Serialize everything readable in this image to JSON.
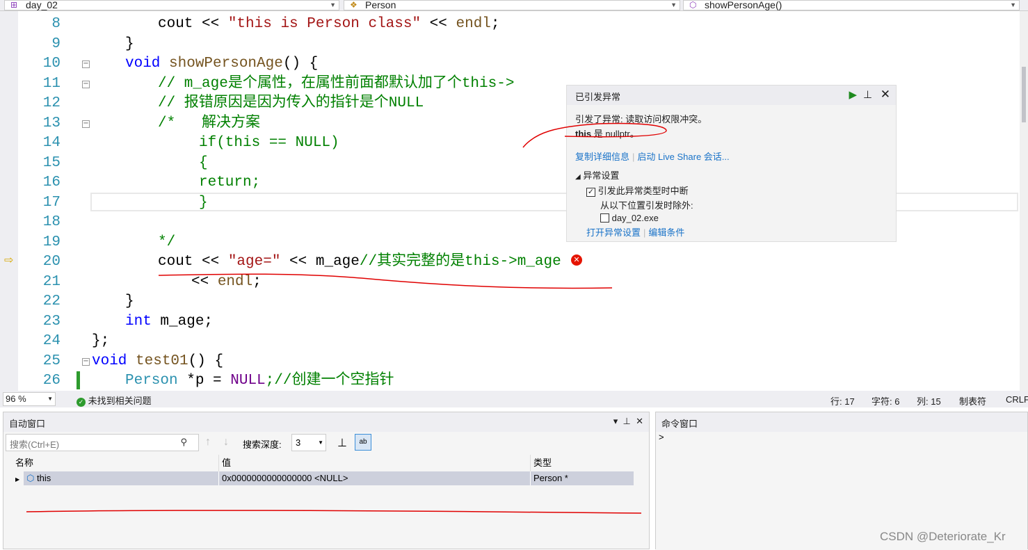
{
  "toolbar": {
    "project": "day_02",
    "class_scope": "Person",
    "member_scope": "showPersonAge()"
  },
  "colors": {
    "keyword": "#0000ff",
    "string": "#a31515",
    "comment": "#008000",
    "type": "#2b91af",
    "macro": "#6f008a",
    "func": "#74531f",
    "plain": "#000000",
    "error": "#e51400",
    "annotation": "#e00000"
  },
  "code_lines": [
    {
      "n": "8",
      "indent": 227,
      "fold": false,
      "segs": [
        [
          "cout ",
          "plain"
        ],
        [
          "<< ",
          "plain"
        ],
        [
          "\"this is Person class\"",
          "string"
        ],
        [
          " << ",
          "plain"
        ],
        [
          "endl",
          "func"
        ],
        [
          ";",
          "plain"
        ]
      ]
    },
    {
      "n": "9",
      "indent": 180,
      "fold": false,
      "segs": [
        [
          "}",
          "plain"
        ]
      ]
    },
    {
      "n": "10",
      "indent": 180,
      "fold": true,
      "segs": [
        [
          "void ",
          "keyword"
        ],
        [
          "showPersonAge",
          "func"
        ],
        [
          "() {",
          "plain"
        ]
      ]
    },
    {
      "n": "11",
      "indent": 227,
      "fold": true,
      "segs": [
        [
          "// m_age是个属性，在属性前面都默认加了个this->",
          "comment"
        ]
      ]
    },
    {
      "n": "12",
      "indent": 227,
      "fold": false,
      "segs": [
        [
          "// 报错原因是因为传入的指针是个NULL",
          "comment"
        ]
      ]
    },
    {
      "n": "13",
      "indent": 227,
      "fold": true,
      "segs": [
        [
          "/*   解决方案",
          "comment"
        ]
      ]
    },
    {
      "n": "14",
      "indent": 286,
      "fold": false,
      "segs": [
        [
          "if(this == NULL)",
          "comment"
        ]
      ]
    },
    {
      "n": "15",
      "indent": 286,
      "fold": false,
      "segs": [
        [
          "{",
          "comment"
        ]
      ]
    },
    {
      "n": "16",
      "indent": 286,
      "fold": false,
      "segs": [
        [
          "return;",
          "comment"
        ]
      ]
    },
    {
      "n": "17",
      "indent": 286,
      "fold": false,
      "segs": [
        [
          "}",
          "comment"
        ]
      ]
    },
    {
      "n": "18",
      "indent": 227,
      "fold": false,
      "segs": []
    },
    {
      "n": "19",
      "indent": 227,
      "fold": false,
      "segs": [
        [
          "*/",
          "comment"
        ]
      ]
    },
    {
      "n": "20",
      "indent": 227,
      "fold": false,
      "segs": [
        [
          "cout ",
          "plain"
        ],
        [
          "<< ",
          "plain"
        ],
        [
          "\"age=\"",
          "string"
        ],
        [
          " << ",
          "plain"
        ],
        [
          "m_age",
          "plain"
        ],
        [
          "//其实完整的是this->m_age",
          "comment"
        ]
      ]
    },
    {
      "n": "21",
      "indent": 275,
      "fold": false,
      "segs": [
        [
          "<< ",
          "plain"
        ],
        [
          "endl",
          "func"
        ],
        [
          ";",
          "plain"
        ]
      ]
    },
    {
      "n": "22",
      "indent": 180,
      "fold": false,
      "segs": [
        [
          "}",
          "plain"
        ]
      ]
    },
    {
      "n": "23",
      "indent": 180,
      "fold": false,
      "segs": [
        [
          "int ",
          "keyword"
        ],
        [
          "m_age;",
          "plain"
        ]
      ]
    },
    {
      "n": "24",
      "indent": 132,
      "fold": false,
      "segs": [
        [
          "};",
          "plain"
        ]
      ]
    },
    {
      "n": "25",
      "indent": 132,
      "fold": true,
      "segs": [
        [
          "void ",
          "keyword"
        ],
        [
          "test01",
          "func"
        ],
        [
          "() {",
          "plain"
        ]
      ]
    },
    {
      "n": "26",
      "indent": 180,
      "fold": false,
      "segs": [
        [
          "Person ",
          "type"
        ],
        [
          "*p = ",
          "plain"
        ],
        [
          "NULL",
          "macro"
        ],
        [
          ";//创建一个空指针",
          "comment"
        ]
      ]
    }
  ],
  "exception": {
    "title": "已引发异常",
    "message": "引发了异常: 读取访问权限冲突。",
    "detail_bold": "this",
    "detail_rest": " 是 nullptr。",
    "link_copy": "复制详细信息",
    "link_liveshare": "启动 Live Share 会话...",
    "settings_header": "异常设置",
    "break_label": "引发此异常类型时中断",
    "break_checked": true,
    "except_label": "从以下位置引发时除外:",
    "exe_label": "day_02.exe",
    "exe_checked": false,
    "link_open_settings": "打开异常设置",
    "link_edit_conditions": "编辑条件"
  },
  "status": {
    "zoom": "96 %",
    "issues": "未找到相关问题",
    "row": "行: 17",
    "char": "字符: 6",
    "col": "列: 15",
    "tabs": "制表符",
    "eol": "CRLF"
  },
  "autos": {
    "title": "自动窗口",
    "search_placeholder": "搜索(Ctrl+E)",
    "depth_label": "搜索深度:",
    "depth_value": "3",
    "columns": [
      "名称",
      "值",
      "类型"
    ],
    "rows": [
      {
        "name": "this",
        "value": "0x0000000000000000 <NULL>",
        "type": "Person *"
      }
    ]
  },
  "command": {
    "title": "命令窗口",
    "prompt": ">"
  },
  "watermark": "CSDN @Deteriorate_Kr"
}
